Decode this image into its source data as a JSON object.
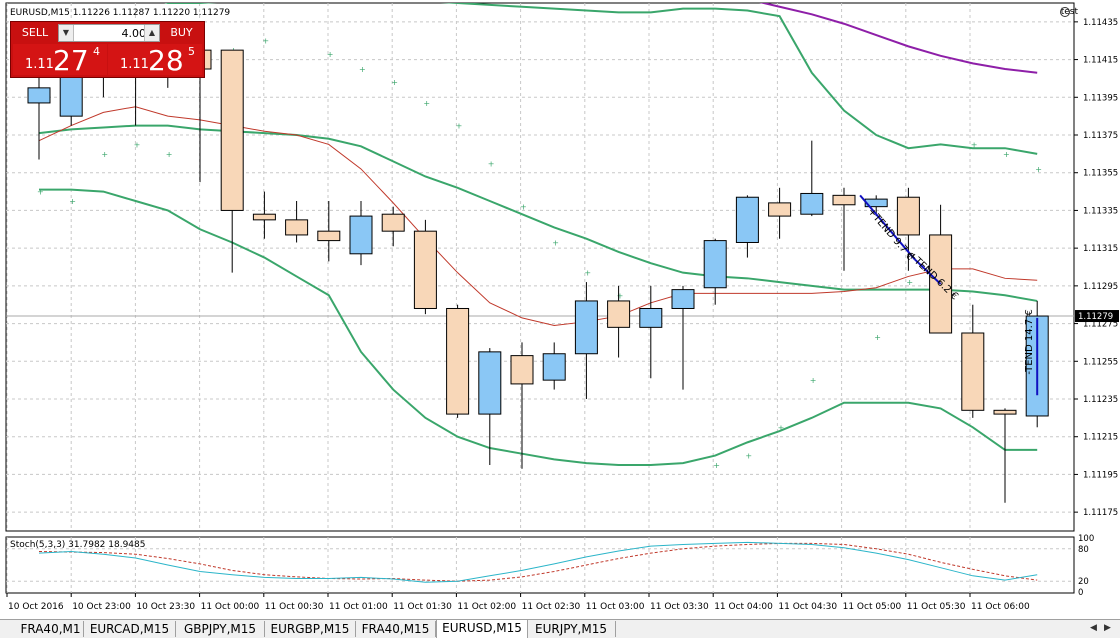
{
  "header": {
    "symbol_info": "EURUSD,M15  1.11226 1.11287 1.11220 1.11279",
    "user": "test",
    "stoch_label": "Stoch(5,3,3) 31.7982 18.9485"
  },
  "trade_panel": {
    "sell_label": "SELL",
    "buy_label": "BUY",
    "lot_value": "4.00",
    "sell_price_small": "1.11",
    "sell_price_big": "27",
    "sell_price_sup": "4",
    "buy_price_small": "1.11",
    "buy_price_big": "28",
    "buy_price_sup": "5"
  },
  "tabs": [
    {
      "label": "FRA40,M1",
      "active": false
    },
    {
      "label": "EURCAD,M15",
      "active": false
    },
    {
      "label": "GBPJPY,M15",
      "active": false
    },
    {
      "label": "EURGBP,M15",
      "active": false
    },
    {
      "label": "FRA40,M15",
      "active": false
    },
    {
      "label": "EURUSD,M15",
      "active": true
    },
    {
      "label": "EURJPY,M15",
      "active": false
    }
  ],
  "colors": {
    "bull": "#8ac7f5",
    "bear": "#f8d7b8",
    "band": "#3aa66b",
    "ma_red": "#c0392b",
    "purple": "#8e1fa8",
    "trend": "#1010c0",
    "stoch_main": "#2bb5c9",
    "stoch_signal": "#c0392b"
  },
  "chart_data": {
    "type": "candlestick",
    "ylim": [
      1.11165,
      1.11445
    ],
    "y_ticks": [
      "1.11435",
      "1.11415",
      "1.11395",
      "1.11375",
      "1.11355",
      "1.11335",
      "1.11315",
      "1.11295",
      "1.11275",
      "1.11255",
      "1.11235",
      "1.11215",
      "1.11195",
      "1.11175"
    ],
    "current_price_label": "1.11279",
    "current_price": 1.11279,
    "x_tick_labels": [
      "10 Oct 2016",
      "10 Oct 23:00",
      "10 Oct 23:30",
      "11 Oct 00:00",
      "11 Oct 00:30",
      "11 Oct 01:00",
      "11 Oct 01:30",
      "11 Oct 02:00",
      "11 Oct 02:30",
      "11 Oct 03:00",
      "11 Oct 03:30",
      "11 Oct 04:00",
      "11 Oct 04:30",
      "11 Oct 05:00",
      "11 Oct 05:30",
      "11 Oct 06:00"
    ],
    "candles": [
      {
        "o": 1.11392,
        "h": 1.1142,
        "l": 1.11362,
        "c": 1.114
      },
      {
        "o": 1.11385,
        "h": 1.11415,
        "l": 1.1138,
        "c": 1.1141
      },
      {
        "o": 1.1141,
        "h": 1.1143,
        "l": 1.11395,
        "c": 1.1142
      },
      {
        "o": 1.1142,
        "h": 1.11425,
        "l": 1.1138,
        "c": 1.1141
      },
      {
        "o": 1.1141,
        "h": 1.1143,
        "l": 1.114,
        "c": 1.1142
      },
      {
        "o": 1.1142,
        "h": 1.1143,
        "l": 1.1135,
        "c": 1.1141
      },
      {
        "o": 1.1142,
        "h": 1.1142,
        "l": 1.11302,
        "c": 1.11335
      },
      {
        "o": 1.11333,
        "h": 1.11345,
        "l": 1.1132,
        "c": 1.1133
      },
      {
        "o": 1.1133,
        "h": 1.1134,
        "l": 1.11318,
        "c": 1.11322
      },
      {
        "o": 1.11324,
        "h": 1.1134,
        "l": 1.11308,
        "c": 1.11319
      },
      {
        "o": 1.11312,
        "h": 1.1134,
        "l": 1.11306,
        "c": 1.11332
      },
      {
        "o": 1.11333,
        "h": 1.11337,
        "l": 1.11316,
        "c": 1.11324
      },
      {
        "o": 1.11324,
        "h": 1.1133,
        "l": 1.1128,
        "c": 1.11283
      },
      {
        "o": 1.11283,
        "h": 1.11285,
        "l": 1.11225,
        "c": 1.11227
      },
      {
        "o": 1.11227,
        "h": 1.11262,
        "l": 1.112,
        "c": 1.1126
      },
      {
        "o": 1.11258,
        "h": 1.11265,
        "l": 1.11198,
        "c": 1.11243
      },
      {
        "o": 1.11245,
        "h": 1.11265,
        "l": 1.1124,
        "c": 1.11259
      },
      {
        "o": 1.11259,
        "h": 1.11297,
        "l": 1.11235,
        "c": 1.11287
      },
      {
        "o": 1.11287,
        "h": 1.11295,
        "l": 1.11257,
        "c": 1.11273
      },
      {
        "o": 1.11273,
        "h": 1.11295,
        "l": 1.11246,
        "c": 1.11283
      },
      {
        "o": 1.11283,
        "h": 1.11295,
        "l": 1.1124,
        "c": 1.11293
      },
      {
        "o": 1.11294,
        "h": 1.1132,
        "l": 1.11285,
        "c": 1.11319
      },
      {
        "o": 1.11318,
        "h": 1.11343,
        "l": 1.1131,
        "c": 1.11342
      },
      {
        "o": 1.11339,
        "h": 1.11347,
        "l": 1.1132,
        "c": 1.11332
      },
      {
        "o": 1.11333,
        "h": 1.11372,
        "l": 1.11332,
        "c": 1.11344
      },
      {
        "o": 1.11343,
        "h": 1.11347,
        "l": 1.11303,
        "c": 1.11338
      },
      {
        "o": 1.11337,
        "h": 1.11343,
        "l": 1.11332,
        "c": 1.11341
      },
      {
        "o": 1.11342,
        "h": 1.11347,
        "l": 1.11303,
        "c": 1.11322
      },
      {
        "o": 1.11322,
        "h": 1.11338,
        "l": 1.11272,
        "c": 1.1127
      },
      {
        "o": 1.1127,
        "h": 1.11285,
        "l": 1.11225,
        "c": 1.11229
      },
      {
        "o": 1.11229,
        "h": 1.1123,
        "l": 1.1118,
        "c": 1.11227
      },
      {
        "o": 1.11226,
        "h": 1.11287,
        "l": 1.1122,
        "c": 1.11279
      }
    ],
    "upper_band": [
      1.1146,
      1.11458,
      1.11455,
      1.1145,
      1.11445,
      1.11445,
      1.11446,
      1.11446,
      1.11447,
      1.11447,
      1.11447,
      1.11447,
      1.11446,
      1.11445,
      1.11444,
      1.11443,
      1.11442,
      1.11441,
      1.1144,
      1.1144,
      1.11442,
      1.11442,
      1.11441,
      1.11438,
      1.11408,
      1.11388,
      1.11375,
      1.11368,
      1.1137,
      1.11368,
      1.11368,
      1.11365
    ],
    "middle_band": [
      1.11376,
      1.11378,
      1.11379,
      1.1138,
      1.1138,
      1.11378,
      1.11377,
      1.11376,
      1.11375,
      1.11373,
      1.11369,
      1.11361,
      1.11353,
      1.11347,
      1.1134,
      1.11333,
      1.11326,
      1.1132,
      1.11313,
      1.11307,
      1.11302,
      1.113,
      1.11299,
      1.11297,
      1.11295,
      1.11293,
      1.11293,
      1.11293,
      1.11293,
      1.11292,
      1.1129,
      1.11287
    ],
    "lower_band": [
      1.11346,
      1.11346,
      1.11345,
      1.1134,
      1.11335,
      1.11325,
      1.11318,
      1.1131,
      1.113,
      1.1129,
      1.1126,
      1.1124,
      1.11225,
      1.11215,
      1.11209,
      1.11206,
      1.11203,
      1.11201,
      1.112,
      1.112,
      1.11201,
      1.11205,
      1.11212,
      1.11218,
      1.11225,
      1.11233,
      1.11233,
      1.11233,
      1.1123,
      1.1122,
      1.11208,
      1.11208
    ],
    "ma_red": [
      1.11372,
      1.1138,
      1.11387,
      1.1139,
      1.11385,
      1.11383,
      1.1138,
      1.11377,
      1.11375,
      1.1137,
      1.11357,
      1.11339,
      1.1132,
      1.11302,
      1.11286,
      1.11278,
      1.11274,
      1.11276,
      1.11279,
      1.11286,
      1.11291,
      1.11291,
      1.11291,
      1.11291,
      1.11291,
      1.11292,
      1.11294,
      1.113,
      1.11304,
      1.11304,
      1.11299,
      1.11298
    ],
    "purple_line": [
      1.1146,
      1.1146,
      1.1146,
      1.1146,
      1.1146,
      1.1146,
      1.1146,
      1.1146,
      1.1146,
      1.1146,
      1.1146,
      1.1146,
      1.1146,
      1.1146,
      1.1146,
      1.1146,
      1.1146,
      1.1146,
      1.1146,
      1.1146,
      1.1146,
      1.1145,
      1.11447,
      1.11443,
      1.11439,
      1.11434,
      1.11428,
      1.11422,
      1.11417,
      1.11413,
      1.1141,
      1.11408
    ],
    "sar_points": [
      {
        "i": 0,
        "y": 1.11345
      },
      {
        "i": 1,
        "y": 1.1134
      },
      {
        "i": 2,
        "y": 1.11365
      },
      {
        "i": 3,
        "y": 1.1137
      },
      {
        "i": 4,
        "y": 1.11365
      },
      {
        "i": 6,
        "y": 1.1142
      },
      {
        "i": 7,
        "y": 1.11425
      },
      {
        "i": 9,
        "y": 1.11418
      },
      {
        "i": 10,
        "y": 1.1141
      },
      {
        "i": 11,
        "y": 1.11403
      },
      {
        "i": 12,
        "y": 1.11392
      },
      {
        "i": 13,
        "y": 1.1138
      },
      {
        "i": 14,
        "y": 1.1136
      },
      {
        "i": 15,
        "y": 1.11337
      },
      {
        "i": 16,
        "y": 1.11318
      },
      {
        "i": 17,
        "y": 1.11302
      },
      {
        "i": 18,
        "y": 1.1129
      },
      {
        "i": 19,
        "y": 1.1128
      },
      {
        "i": 21,
        "y": 1.112
      },
      {
        "i": 22,
        "y": 1.11205
      },
      {
        "i": 23,
        "y": 1.1122
      },
      {
        "i": 24,
        "y": 1.11245
      },
      {
        "i": 26,
        "y": 1.11268
      },
      {
        "i": 27,
        "y": 1.11297
      },
      {
        "i": 28,
        "y": 1.11318
      },
      {
        "i": 29,
        "y": 1.1137
      },
      {
        "i": 30,
        "y": 1.11365
      },
      {
        "i": 31,
        "y": 1.11357
      }
    ],
    "trend_lines": [
      {
        "label": "+TEND 9.7 €",
        "i1": 25.5,
        "y1": 1.11343,
        "i2": 27.2,
        "y2": 1.11309
      },
      {
        "label": "+TEND 6.2 €",
        "i1": 27.2,
        "y1": 1.11309,
        "i2": 28.0,
        "y2": 1.11296
      },
      {
        "label": "-TEND 14.7 €",
        "i1": 31,
        "y1": 1.11278,
        "i2": 31,
        "y2": 1.11237
      }
    ],
    "stochastic": {
      "ylim": [
        0,
        100
      ],
      "levels": [
        "100",
        "80",
        "20",
        "0"
      ],
      "main": [
        72,
        75,
        70,
        63,
        50,
        38,
        32,
        27,
        25,
        25,
        27,
        24,
        18,
        20,
        30,
        40,
        52,
        65,
        76,
        85,
        88,
        90,
        92,
        90,
        88,
        82,
        72,
        60,
        45,
        30,
        22,
        32
      ],
      "signal": [
        75,
        74,
        73,
        70,
        62,
        52,
        40,
        32,
        28,
        25,
        24,
        25,
        22,
        20,
        22,
        28,
        38,
        50,
        62,
        72,
        80,
        85,
        88,
        90,
        90,
        88,
        80,
        70,
        55,
        42,
        30,
        22
      ]
    }
  }
}
